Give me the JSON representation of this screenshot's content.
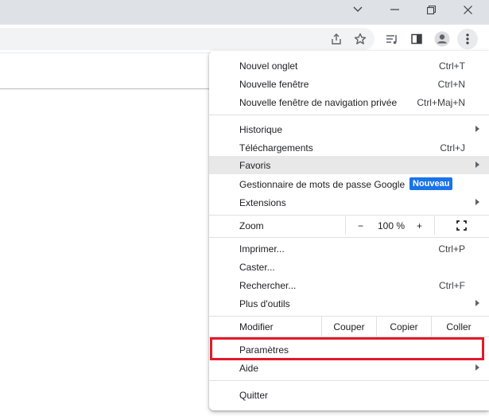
{
  "window": {
    "minimize_icon": "chevron-down-icon",
    "restore_icon": "restore-window-icon",
    "close_icon": "close-icon"
  },
  "toolbar": {
    "icons": [
      "share-icon",
      "star-icon",
      "reading-list-icon",
      "side-panel-icon",
      "profile-icon",
      "kebab-menu-icon"
    ]
  },
  "menu": {
    "group1": [
      {
        "label": "Nouvel onglet",
        "shortcut": "Ctrl+T"
      },
      {
        "label": "Nouvelle fenêtre",
        "shortcut": "Ctrl+N"
      },
      {
        "label": "Nouvelle fenêtre de navigation privée",
        "shortcut": "Ctrl+Maj+N"
      }
    ],
    "group2": [
      {
        "label": "Historique",
        "has_submenu": true
      },
      {
        "label": "Téléchargements",
        "shortcut": "Ctrl+J"
      },
      {
        "label": "Favoris",
        "has_submenu": true,
        "highlighted": true
      },
      {
        "label": "Gestionnaire de mots de passe Google",
        "badge": "Nouveau"
      },
      {
        "label": "Extensions",
        "has_submenu": true
      }
    ],
    "zoom": {
      "label": "Zoom",
      "minus": "−",
      "value": "100 %",
      "plus": "+",
      "fullscreen_icon": "fullscreen-icon"
    },
    "group3": [
      {
        "label": "Imprimer...",
        "shortcut": "Ctrl+P"
      },
      {
        "label": "Caster..."
      },
      {
        "label": "Rechercher...",
        "shortcut": "Ctrl+F"
      },
      {
        "label": "Plus d'outils",
        "has_submenu": true
      }
    ],
    "edit": {
      "label": "Modifier",
      "cut": "Couper",
      "copy": "Copier",
      "paste": "Coller"
    },
    "group4": [
      {
        "label": "Paramètres",
        "focused": true
      },
      {
        "label": "Aide",
        "has_submenu": true
      }
    ],
    "quit": {
      "label": "Quitter"
    }
  },
  "colors": {
    "badge": "#1a73e8",
    "focus_outline": "#e21a27",
    "highlight": "#e8e8e8"
  }
}
